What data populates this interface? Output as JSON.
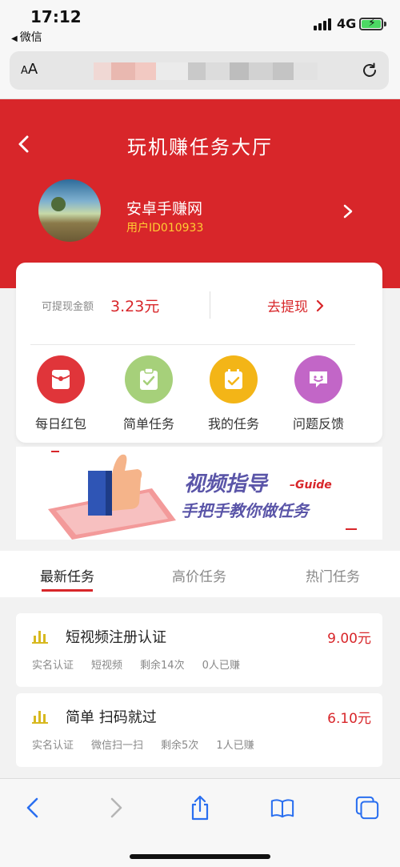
{
  "status_bar": {
    "time": "17:12",
    "back_app": "微信",
    "network": "4G"
  },
  "browser": {
    "text_size_label_small": "A",
    "text_size_label_large": "A"
  },
  "header": {
    "title": "玩机赚任务大厅",
    "user_name": "安卓手赚网",
    "user_id": "用户ID010933"
  },
  "balance": {
    "label": "可提现金额",
    "value": "3.23元",
    "withdraw_label": "去提现"
  },
  "quick_actions": [
    {
      "label": "每日红包",
      "icon": "red-envelope-icon",
      "color": "#e0353a"
    },
    {
      "label": "简单任务",
      "icon": "clipboard-check-icon",
      "color": "#a6d07a"
    },
    {
      "label": "我的任务",
      "icon": "calendar-check-icon",
      "color": "#f3b517"
    },
    {
      "label": "问题反馈",
      "icon": "feedback-icon",
      "color": "#c266c7"
    }
  ],
  "banner": {
    "headline": "视频指导",
    "suffix": "–Guide",
    "subline": "手把手教你做任务"
  },
  "tabs": [
    {
      "label": "最新任务",
      "active": true
    },
    {
      "label": "高价任务",
      "active": false
    },
    {
      "label": "热门任务",
      "active": false
    }
  ],
  "tasks": [
    {
      "title": "短视频注册认证",
      "price": "9.00元",
      "tags": [
        "实名认证",
        "短视频"
      ],
      "remaining": "剩余14次",
      "earned": "0人已赚"
    },
    {
      "title": "简单 扫码就过",
      "price": "6.10元",
      "tags": [
        "实名认证",
        "微信扫一扫"
      ],
      "remaining": "剩余5次",
      "earned": "1人已赚"
    }
  ],
  "colors": {
    "brand_red": "#d8262a",
    "accent_yellow": "#ffcc33"
  }
}
